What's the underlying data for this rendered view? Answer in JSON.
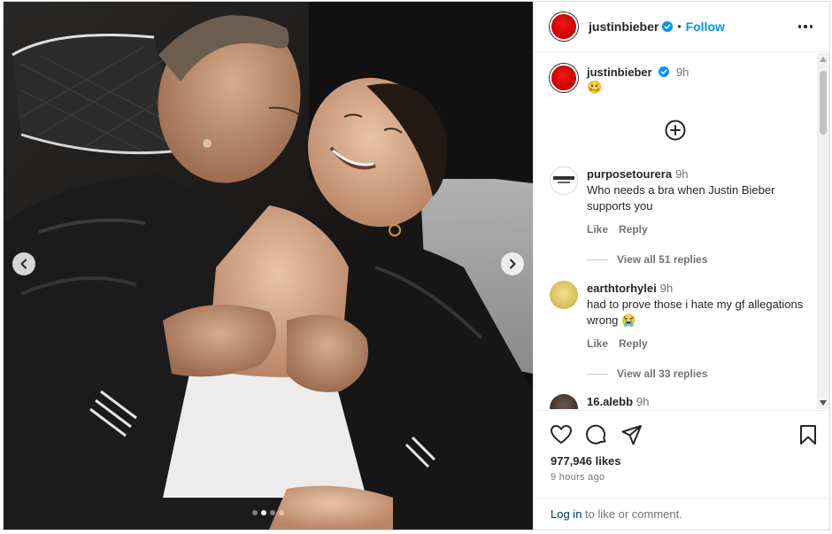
{
  "post": {
    "carousel": {
      "slide_count": 4,
      "active_slide": 2
    },
    "header": {
      "username": "justinbieber",
      "verified": true,
      "separator": "•",
      "follow_label": "Follow"
    },
    "caption": {
      "username": "justinbieber",
      "time": "9h",
      "text": "🥴"
    },
    "comments": [
      {
        "username": "purposetourera",
        "time": "9h",
        "text": "Who needs a bra when Justin Bieber supports you",
        "like_label": "Like",
        "reply_label": "Reply",
        "view_replies": "View all 51 replies"
      },
      {
        "username": "earthtorhylei",
        "time": "9h",
        "text": "had to prove those i hate my gf allegations wrong 😭",
        "like_label": "Like",
        "reply_label": "Reply",
        "view_replies": "View all 33 replies"
      },
      {
        "username": "16.alebb",
        "time": "9h"
      }
    ],
    "likes": "977,946 likes",
    "posted_ago": "9 hours ago",
    "login": {
      "link": "Log in",
      "rest": " to like or comment."
    }
  },
  "icons": [
    "chevron-left-icon",
    "chevron-right-icon",
    "verified-badge-icon",
    "more-options-icon",
    "add-circle-icon",
    "heart-icon",
    "comment-icon",
    "share-icon",
    "bookmark-icon"
  ],
  "colors": {
    "accent": "#0095f6",
    "link": "#00376b",
    "muted": "#737373",
    "avatar_red": "#d40000"
  }
}
